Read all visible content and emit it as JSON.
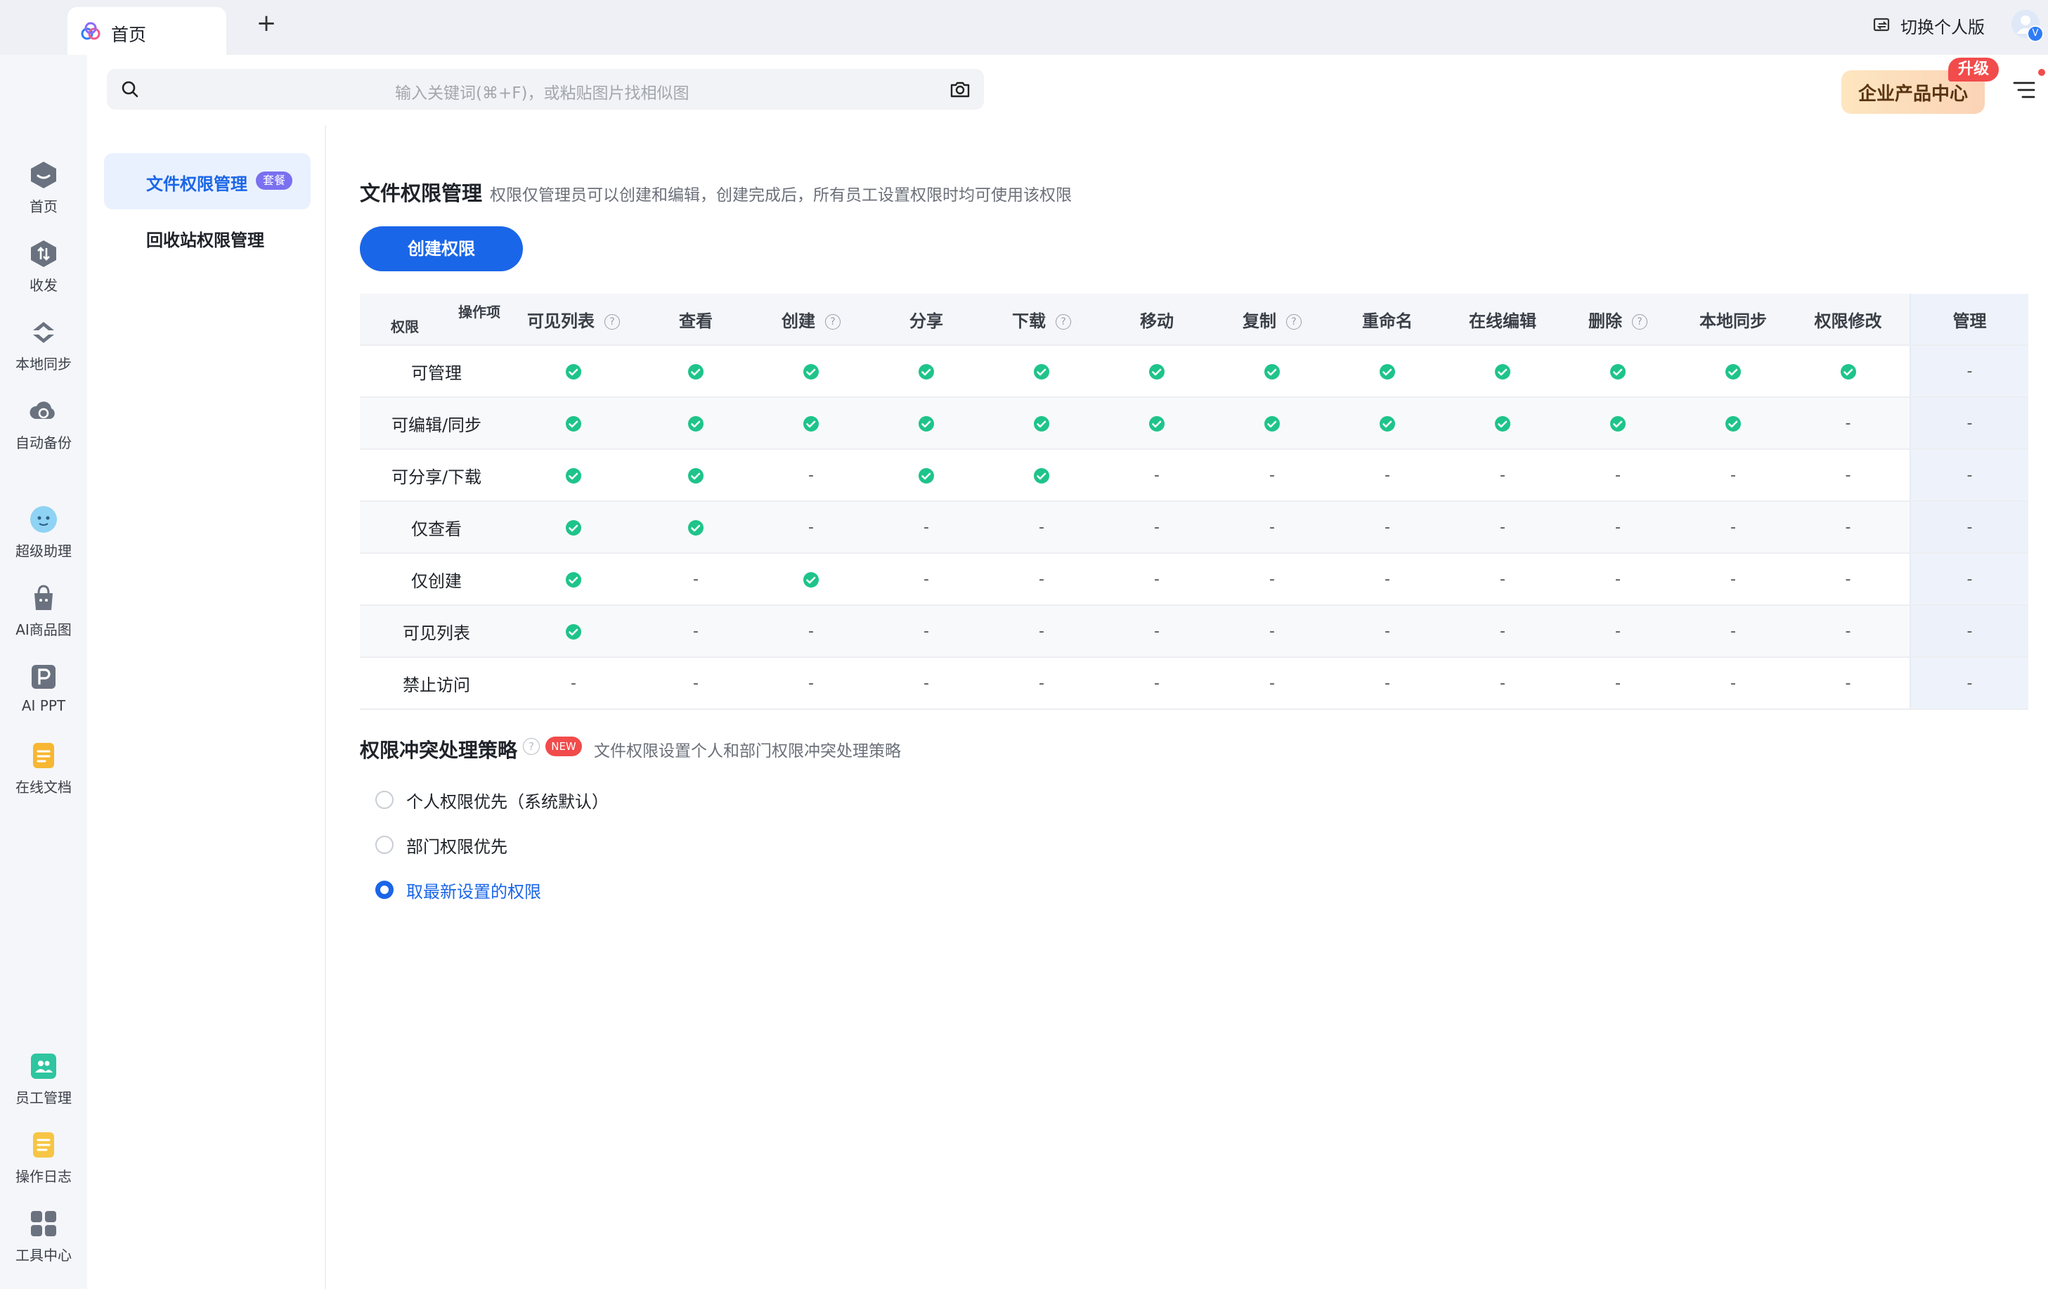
{
  "tabbar": {
    "tab_title": "首页",
    "add_icon": "plus-icon",
    "switch_label": "切换个人版",
    "avatar_badge": "V"
  },
  "sidebar": {
    "items": [
      {
        "label": "首页",
        "icon": "home-icon"
      },
      {
        "label": "收发",
        "icon": "transfer-icon"
      },
      {
        "label": "本地同步",
        "icon": "sync-icon"
      },
      {
        "label": "自动备份",
        "icon": "backup-icon"
      },
      {
        "label": "超级助理",
        "icon": "assistant-icon"
      },
      {
        "label": "AI商品图",
        "icon": "ai-product-icon"
      },
      {
        "label": "AI PPT",
        "icon": "ai-ppt-icon"
      },
      {
        "label": "在线文档",
        "icon": "online-doc-icon"
      },
      {
        "label": "员工管理",
        "icon": "staff-icon"
      },
      {
        "label": "操作日志",
        "icon": "log-icon"
      },
      {
        "label": "工具中心",
        "icon": "tools-icon"
      }
    ]
  },
  "header": {
    "search_placeholder": "输入关键词(⌘+F)，或粘贴图片找相似图",
    "enterprise_label": "企业产品中心",
    "upgrade_label": "升级"
  },
  "submenu": {
    "items": [
      {
        "label": "文件权限管理",
        "badge": "套餐",
        "active": true
      },
      {
        "label": "回收站权限管理",
        "active": false
      }
    ]
  },
  "main": {
    "title": "文件权限管理",
    "description": "权限仅管理员可以创建和编辑，创建完成后，所有员工设置权限时均可使用该权限",
    "create_button": "创建权限",
    "table": {
      "corner_top": "操作项",
      "corner_bottom": "权限",
      "columns": [
        "可见列表",
        "查看",
        "创建",
        "分享",
        "下载",
        "移动",
        "复制",
        "重命名",
        "在线编辑",
        "删除",
        "本地同步",
        "权限修改",
        "管理"
      ],
      "help_columns": [
        true,
        false,
        true,
        false,
        true,
        false,
        true,
        false,
        false,
        true,
        false,
        false,
        false
      ],
      "rows": [
        {
          "label": "可管理",
          "values": [
            1,
            1,
            1,
            1,
            1,
            1,
            1,
            1,
            1,
            1,
            1,
            1,
            0
          ]
        },
        {
          "label": "可编辑/同步",
          "values": [
            1,
            1,
            1,
            1,
            1,
            1,
            1,
            1,
            1,
            1,
            1,
            0,
            0
          ]
        },
        {
          "label": "可分享/下载",
          "values": [
            1,
            1,
            0,
            1,
            1,
            0,
            0,
            0,
            0,
            0,
            0,
            0,
            0
          ]
        },
        {
          "label": "仅查看",
          "values": [
            1,
            1,
            0,
            0,
            0,
            0,
            0,
            0,
            0,
            0,
            0,
            0,
            0
          ]
        },
        {
          "label": "仅创建",
          "values": [
            1,
            0,
            1,
            0,
            0,
            0,
            0,
            0,
            0,
            0,
            0,
            0,
            0
          ]
        },
        {
          "label": "可见列表",
          "values": [
            1,
            0,
            0,
            0,
            0,
            0,
            0,
            0,
            0,
            0,
            0,
            0,
            0
          ]
        },
        {
          "label": "禁止访问",
          "values": [
            0,
            0,
            0,
            0,
            0,
            0,
            0,
            0,
            0,
            0,
            0,
            0,
            0
          ]
        }
      ],
      "empty_mark": "-"
    },
    "conflict": {
      "title": "权限冲突处理策略",
      "help": "?",
      "new_badge": "NEW",
      "description": "文件权限设置个人和部门权限冲突处理策略",
      "options": [
        {
          "label": "个人权限优先（系统默认）",
          "selected": false
        },
        {
          "label": "部门权限优先",
          "selected": false
        },
        {
          "label": "取最新设置的权限",
          "selected": true
        }
      ]
    }
  },
  "colors": {
    "accent": "#1a66e8",
    "check": "#1ec48a",
    "upgrade": "#f24b4b",
    "badge_purple": "#7a70f0"
  }
}
